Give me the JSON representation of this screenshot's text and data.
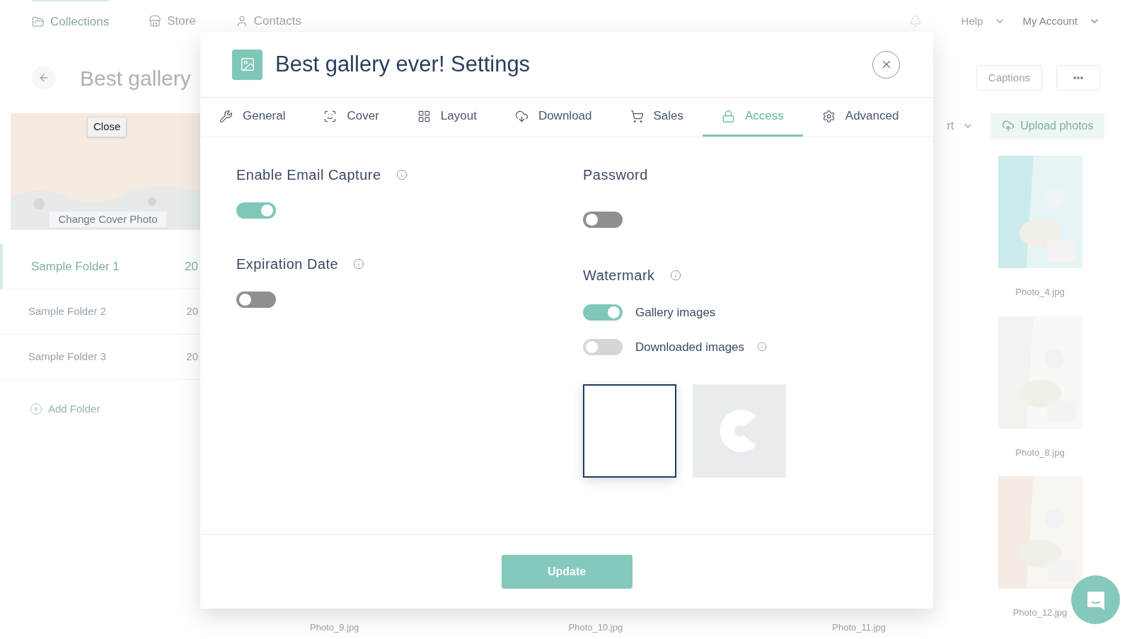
{
  "nav": {
    "items": [
      {
        "label": "Collections",
        "selected": true
      },
      {
        "label": "Store",
        "selected": false
      },
      {
        "label": "Contacts",
        "selected": false
      }
    ],
    "help": "Help",
    "account": "My Account"
  },
  "gallery": {
    "title": "Best gallery",
    "captions": "Captions",
    "more": "•••",
    "sort_partial": "rt",
    "upload": "Upload photos"
  },
  "sidebar": {
    "tooltip": "Close",
    "cover_action": "Change Cover Photo",
    "folders": [
      {
        "name": "Sample Folder 1",
        "count": "20",
        "selected": true
      },
      {
        "name": "Sample Folder 2",
        "count": "20",
        "selected": false
      },
      {
        "name": "Sample Folder 3",
        "count": "20",
        "selected": false
      }
    ],
    "add_folder": "Add Folder"
  },
  "photos": [
    {
      "name": "Photo_4.jpg"
    },
    {
      "name": "Photo_8.jpg"
    },
    {
      "name": "Photo_12.jpg"
    }
  ],
  "bottom_photo_names": [
    "Photo_9.jpg",
    "Photo_10.jpg",
    "Photo_11.jpg"
  ],
  "modal": {
    "title": "Best gallery ever! Settings",
    "tabs": [
      {
        "label": "General",
        "selected": false
      },
      {
        "label": "Cover",
        "selected": false
      },
      {
        "label": "Layout",
        "selected": false
      },
      {
        "label": "Download",
        "selected": false
      },
      {
        "label": "Sales",
        "selected": false
      },
      {
        "label": "Access",
        "selected": true
      },
      {
        "label": "Advanced",
        "selected": false
      }
    ],
    "left": [
      {
        "title": "Enable Email Capture",
        "info": true,
        "on": true
      },
      {
        "title": "Expiration Date",
        "info": true,
        "on": false
      }
    ],
    "password": {
      "title": "Password",
      "on": false
    },
    "watermark": {
      "title": "Watermark",
      "options": [
        {
          "label": "Gallery images",
          "on": true,
          "disabled": false,
          "info": false
        },
        {
          "label": "Downloaded images",
          "on": false,
          "disabled": true,
          "info": true
        }
      ],
      "styles": [
        {
          "kind": "blank",
          "selected": true
        },
        {
          "kind": "logo",
          "selected": false
        }
      ]
    },
    "button": "Update"
  }
}
